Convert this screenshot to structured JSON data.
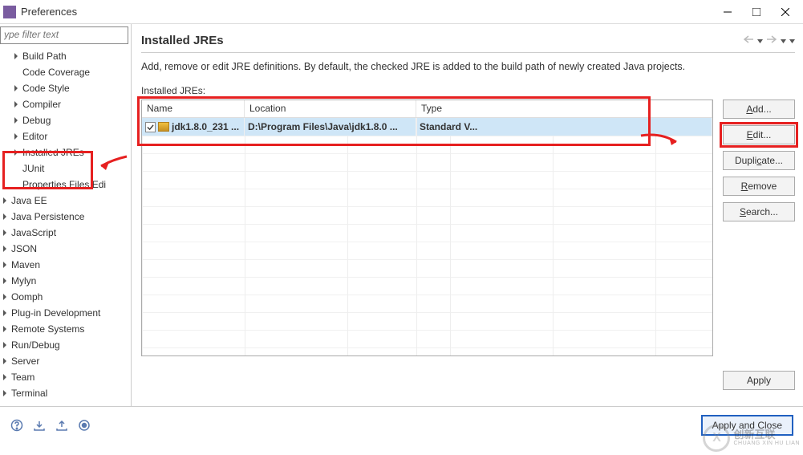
{
  "window": {
    "title": "Preferences"
  },
  "filter": {
    "placeholder": "ype filter text"
  },
  "tree": {
    "items": [
      {
        "label": "Build Path",
        "expandable": true,
        "level": 0
      },
      {
        "label": "Code Coverage",
        "expandable": false,
        "level": 0
      },
      {
        "label": "Code Style",
        "expandable": true,
        "level": 0
      },
      {
        "label": "Compiler",
        "expandable": true,
        "level": 0
      },
      {
        "label": "Debug",
        "expandable": true,
        "level": 0
      },
      {
        "label": "Editor",
        "expandable": true,
        "level": 0
      },
      {
        "label": "Installed JREs",
        "expandable": true,
        "level": 0
      },
      {
        "label": "JUnit",
        "expandable": false,
        "level": 0
      },
      {
        "label": "Properties Files Edi",
        "expandable": false,
        "level": 0
      },
      {
        "label": "Java EE",
        "expandable": true,
        "level": -1
      },
      {
        "label": "Java Persistence",
        "expandable": true,
        "level": -1
      },
      {
        "label": "JavaScript",
        "expandable": true,
        "level": -1
      },
      {
        "label": "JSON",
        "expandable": true,
        "level": -1
      },
      {
        "label": "Maven",
        "expandable": true,
        "level": -1
      },
      {
        "label": "Mylyn",
        "expandable": true,
        "level": -1
      },
      {
        "label": "Oomph",
        "expandable": true,
        "level": -1
      },
      {
        "label": "Plug-in Development",
        "expandable": true,
        "level": -1
      },
      {
        "label": "Remote Systems",
        "expandable": true,
        "level": -1
      },
      {
        "label": "Run/Debug",
        "expandable": true,
        "level": -1
      },
      {
        "label": "Server",
        "expandable": true,
        "level": -1
      },
      {
        "label": "Team",
        "expandable": true,
        "level": -1
      },
      {
        "label": "Terminal",
        "expandable": true,
        "level": -1
      }
    ]
  },
  "page": {
    "title": "Installed JREs",
    "desc": "Add, remove or edit JRE definitions. By default, the checked JRE is added to the build path of newly created Java projects.",
    "table_label": "Installed JREs:",
    "columns": {
      "name": "Name",
      "location": "Location",
      "type": "Type"
    },
    "rows": [
      {
        "name": "jdk1.8.0_231 ...",
        "location": "D:\\Program Files\\Java\\jdk1.8.0 ...",
        "type": "Standard V...",
        "checked": true
      }
    ]
  },
  "buttons": {
    "add": "Add...",
    "edit": "Edit...",
    "duplicate": "Duplicate...",
    "remove": "Remove",
    "search": "Search...",
    "apply": "Apply",
    "apply_close": "Apply and Close"
  },
  "watermark": {
    "cn": "创新互联",
    "en": "CHUANG XIN HU LIAN"
  }
}
